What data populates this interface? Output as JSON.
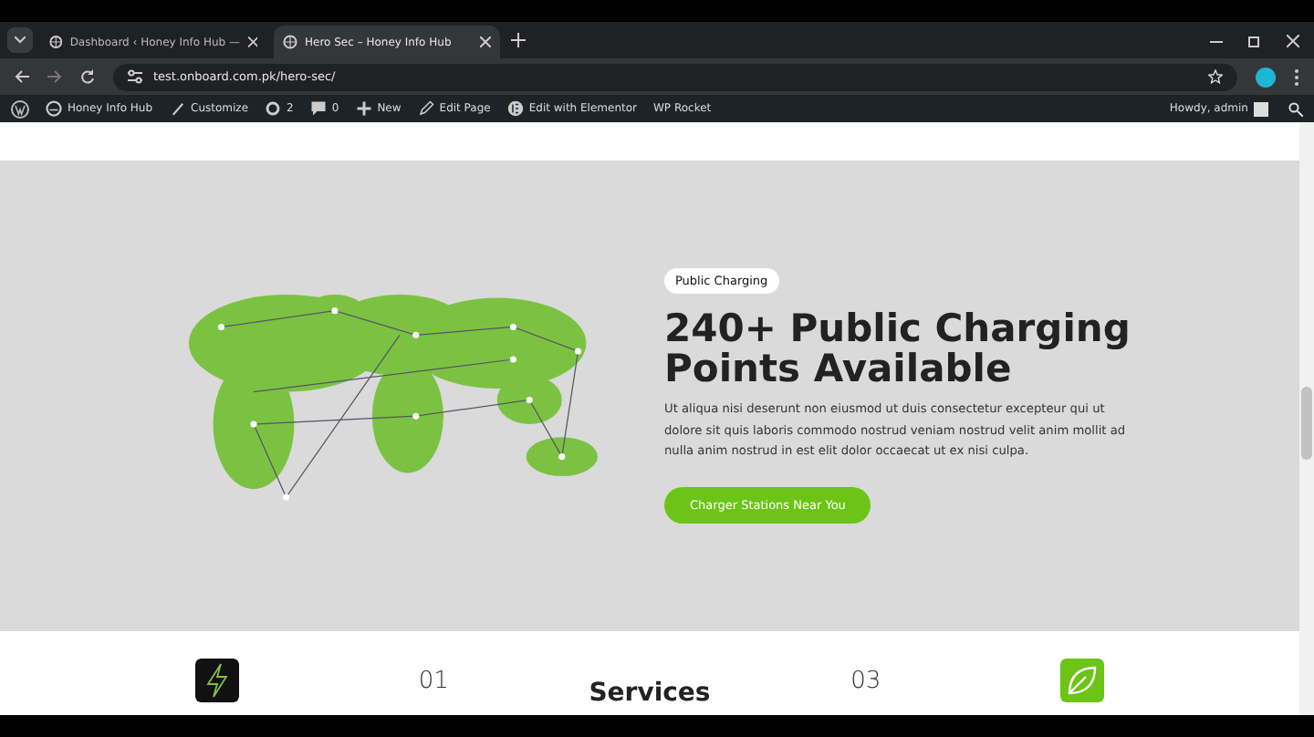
{
  "browser": {
    "tabs": [
      {
        "title": "Dashboard ‹ Honey Info Hub —",
        "selected": false
      },
      {
        "title": "Hero Sec – Honey Info Hub",
        "selected": true
      }
    ],
    "url": "test.onboard.com.pk/hero-sec/"
  },
  "admin_bar": {
    "items": [
      {
        "kind": "site",
        "label": "Honey Info Hub"
      },
      {
        "kind": "customize",
        "label": "Customize"
      },
      {
        "kind": "updates",
        "label": "2"
      },
      {
        "kind": "comments",
        "label": "0"
      },
      {
        "kind": "new",
        "label": "New"
      },
      {
        "kind": "edit",
        "label": "Edit Page"
      },
      {
        "kind": "elementor",
        "label": "Edit with Elementor"
      },
      {
        "kind": "plain",
        "label": "WP Rocket"
      }
    ],
    "greeting": "Howdy, admin"
  },
  "hero": {
    "badge": "Public Charging",
    "heading": "240+ Public Charging Points Available",
    "text": "Ut aliqua nisi deserunt non eiusmod ut duis consectetur excepteur qui ut dolore sit quis laboris commodo nostrud veniam nostrud velit anim mollit ad nulla anim nostrud in est elit dolor occaecat ut ex nisi culpa.",
    "button": "Charger Stations Near You"
  },
  "services": {
    "items": [
      {
        "kind": "icon"
      },
      {
        "kind": "number",
        "text": "01"
      },
      {
        "kind": "title",
        "text": "Services"
      },
      {
        "kind": "number",
        "text": "03"
      },
      {
        "kind": "icon"
      }
    ]
  }
}
